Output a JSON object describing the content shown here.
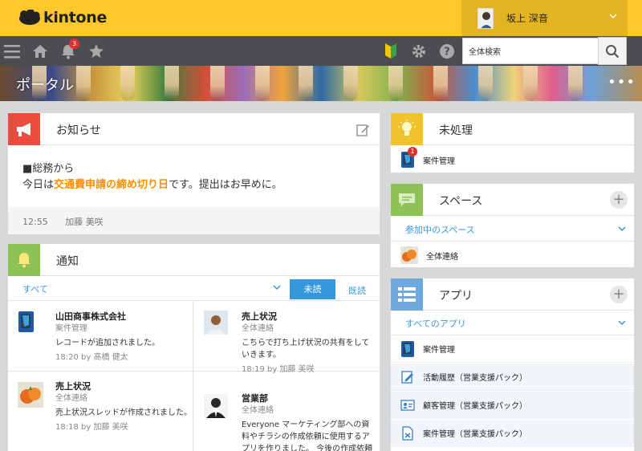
{
  "header": {
    "logo_text": "kintone",
    "user_name": "坂上 深音",
    "brand_color": "#fcc82c"
  },
  "navbar": {
    "notification_count": "3",
    "search_placeholder": "全体検索"
  },
  "banner": {
    "title": "ポータル"
  },
  "announcement": {
    "title": "お知らせ",
    "line1": "■総務から",
    "line2_prefix": "今日は",
    "line2_highlight": "交通費申請の締め切り日",
    "line2_suffix": "です。提出はお早めに。",
    "time": "12:55",
    "author": "加藤 美咲",
    "highlight_color": "#ff8c00"
  },
  "notifications": {
    "title": "通知",
    "filter": "すべて",
    "tab_unread": "未読",
    "tab_read": "既読",
    "items": [
      {
        "title": "山田商事株式会社",
        "app": "案件管理",
        "message": "レコードが追加されました。",
        "meta": "18:20  by 髙橋 健太",
        "icon": "app-book-icon"
      },
      {
        "title": "売上状況",
        "app": "全体連絡",
        "message": "こちらで打ち上げ状況の共有をしていきます。",
        "meta": "18:19  by 加藤 美咲",
        "icon": "person-photo"
      },
      {
        "title": "売上状況",
        "app": "全体連絡",
        "message": "売上状況スレッドが作成されました。",
        "meta": "18:18  by 加藤 美咲",
        "icon": "fruit-photo"
      },
      {
        "title": "営業部",
        "app": "全体連絡",
        "message": "Everyone マーケティング部への資料やチラシの作成依頼に使用するアプリを作りました。 今後の作成依頼に",
        "meta": "",
        "icon": "person-photo"
      }
    ]
  },
  "pending": {
    "title": "未処理",
    "badge": "1",
    "item": "案件管理"
  },
  "spaces": {
    "title": "スペース",
    "sub": "参加中のスペース",
    "item": "全体連絡"
  },
  "apps": {
    "title": "アプリ",
    "sub": "すべてのアプリ",
    "items": [
      "案件管理",
      "活動履歴（営業支援パック）",
      "顧客管理（営業支援パック）",
      "案件管理（営業支援パック）"
    ]
  }
}
